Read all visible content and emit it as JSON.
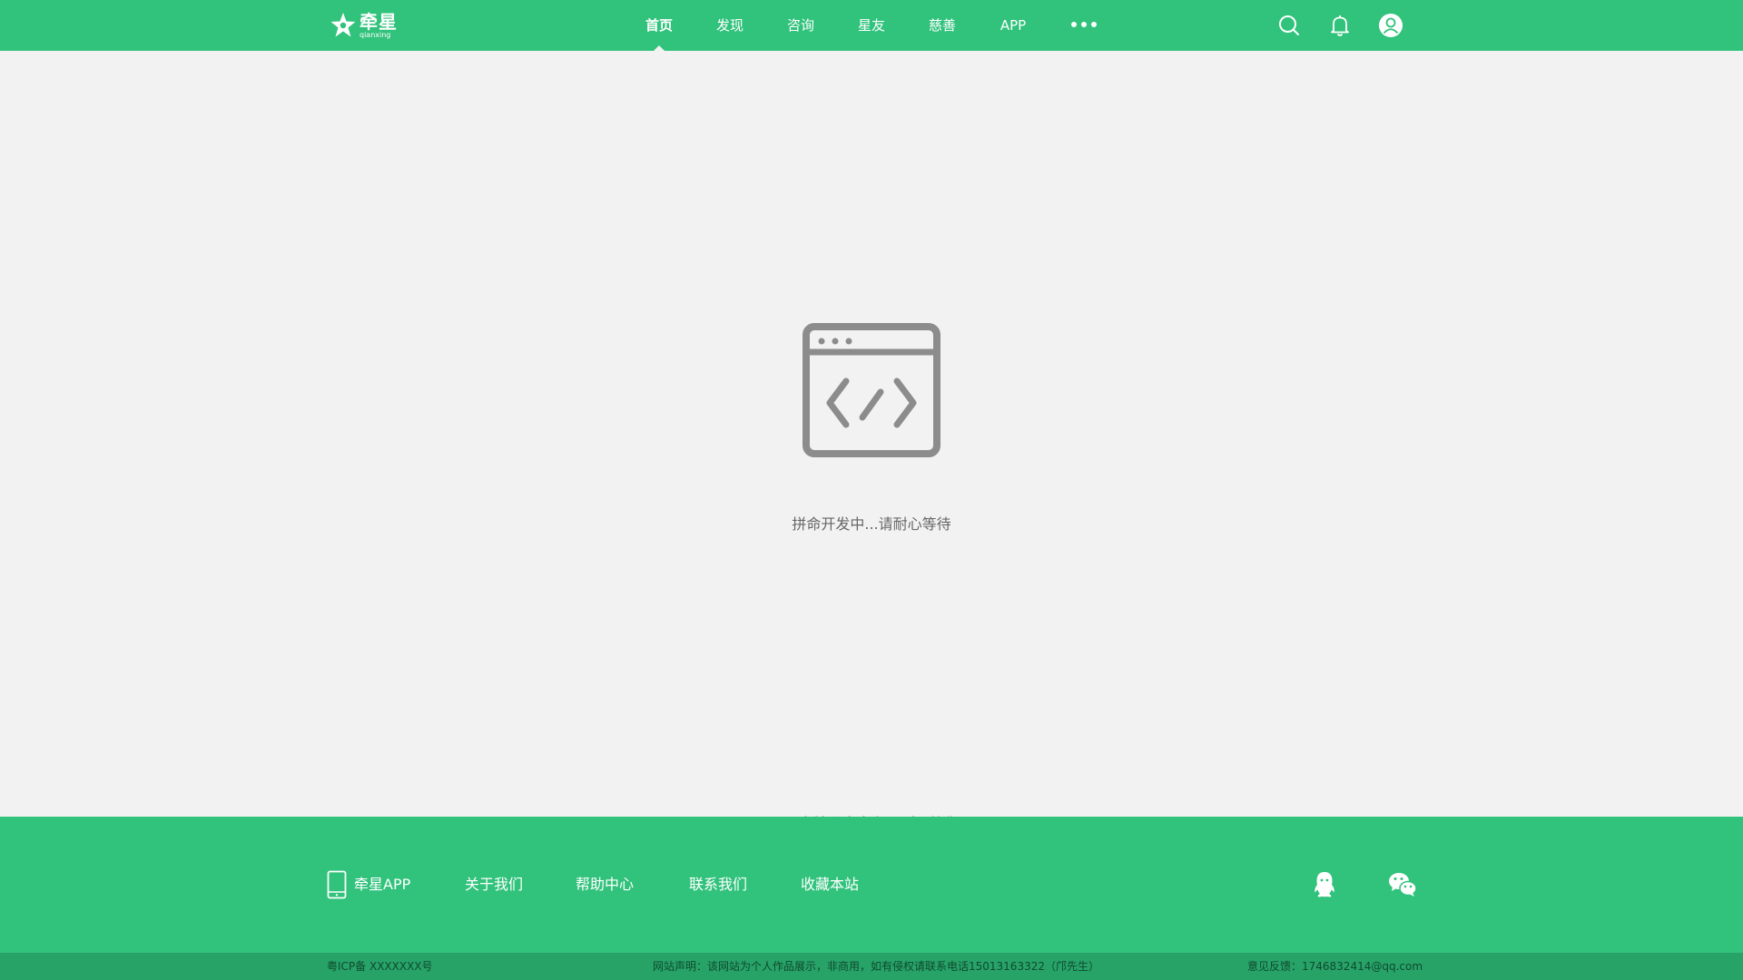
{
  "brand": {
    "name_cn": "牵星",
    "name_en": "qianxing",
    "logo_icon": "star-logo-icon"
  },
  "nav": {
    "items": [
      {
        "label": "首页",
        "active": true
      },
      {
        "label": "发现",
        "active": false
      },
      {
        "label": "咨询",
        "active": false
      },
      {
        "label": "星友",
        "active": false
      },
      {
        "label": "慈善",
        "active": false
      },
      {
        "label": "APP",
        "active": false
      }
    ],
    "more_icon": "more-dots-icon"
  },
  "header_icons": [
    "search-icon",
    "bell-icon",
    "user-avatar-icon"
  ],
  "main": {
    "dev_icon": "code-window-icon",
    "dev_message": "拼命开发中...请耐心等待",
    "more_message": "更多精彩内容在“星友”等你"
  },
  "footer": {
    "app_label": "牵星APP",
    "app_icon": "phone-icon",
    "links": [
      "关于我们",
      "帮助中心",
      "联系我们",
      "收藏本站"
    ],
    "social_icons": [
      "qq-icon",
      "wechat-icon"
    ]
  },
  "bottom_bar": {
    "icp": "粤ICP备 XXXXXXX号",
    "statement": "网站声明：该网站为个人作品展示，非商用，如有侵权请联系电话15013163322（邝先生）",
    "feedback": "意见反馈：1746832414@qq.com"
  },
  "colors": {
    "brand_green": "#31c27c",
    "bottom_green": "#27a368",
    "page_bg": "#f2f2f2",
    "icon_gray": "#8c8c8c"
  }
}
